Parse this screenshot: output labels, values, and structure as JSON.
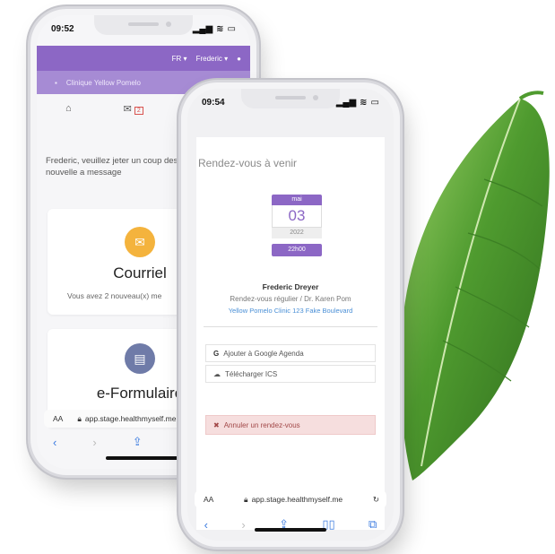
{
  "phone1": {
    "status": {
      "time": "09:52"
    },
    "topbar": {
      "lang": "FR ▾",
      "user": "Frederic ▾"
    },
    "clinic_bar": {
      "name": "Clinique Yellow Pomelo"
    },
    "nav": {
      "mail_badge": "2"
    },
    "welcome_text": "Frederic, veuillez jeter un coup dessous pour toute nouvelle a message",
    "mail_card": {
      "title": "Courriel",
      "subtitle": "Vous avez 2 nouveau(x) me"
    },
    "form_card": {
      "title": "e-Formulaire"
    },
    "browser": {
      "text_size": "AA",
      "url": "app.stage.healthmyself.me"
    }
  },
  "phone2": {
    "status": {
      "time": "09:54"
    },
    "heading": "Rendez-vous à venir",
    "calendar": {
      "month": "mai",
      "day": "03",
      "year": "2022",
      "time": "22h00"
    },
    "patient_name": "Frederic Dreyer",
    "appointment_type": "Rendez-vous régulier / Dr. Karen Pom",
    "location": "Yellow Pomelo Clinic 123 Fake Boulevard",
    "actions": {
      "google": "Ajouter à Google Agenda",
      "ics": "Télécharger ICS",
      "cancel": "Annuler un rendez-vous"
    },
    "browser": {
      "text_size": "AA",
      "url": "app.stage.healthmyself.me"
    }
  },
  "colors": {
    "brand_purple": "#8c67c5",
    "clinic_bar": "#a68bd4",
    "mail_icon": "#f4b33d",
    "form_icon": "#6f7ba8",
    "link_blue": "#4a8fd6",
    "cancel_bg": "#f6dede",
    "leaf_green": "#3f8a2a"
  }
}
